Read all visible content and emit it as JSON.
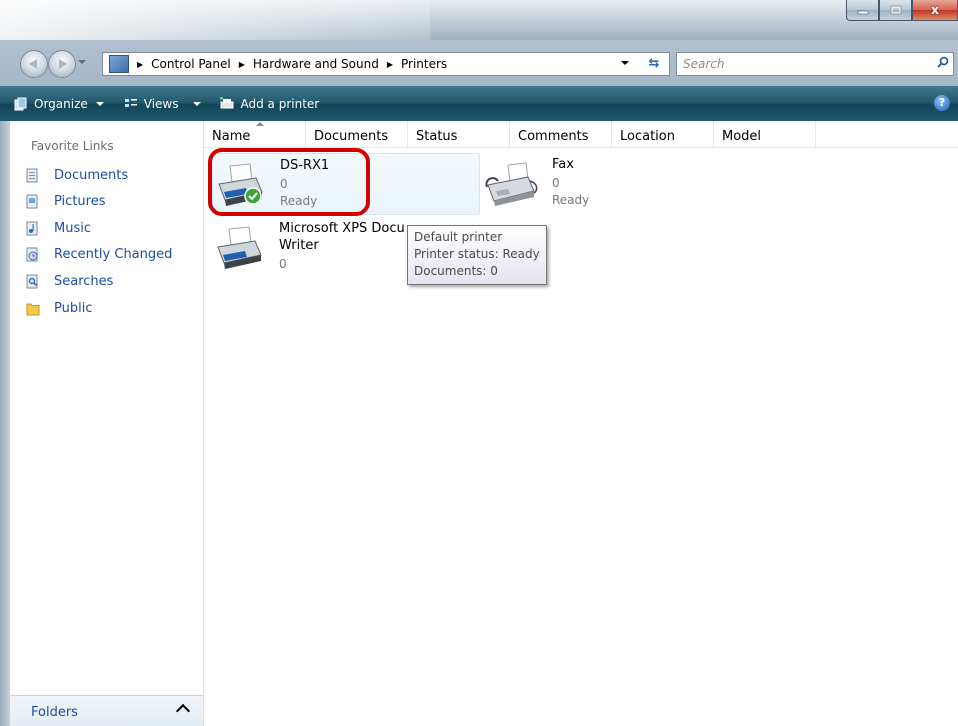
{
  "window": {
    "minimize_icon": "minimize-icon",
    "maximize_icon": "maximize-icon",
    "close_glyph": "x"
  },
  "address": {
    "breadcrumbs": [
      "Control Panel",
      "Hardware and Sound",
      "Printers"
    ],
    "search_placeholder": "Search"
  },
  "toolbar": {
    "organize_label": "Organize",
    "views_label": "Views",
    "add_printer_label": "Add a printer",
    "help_label": "?"
  },
  "sidebar": {
    "header": "Favorite Links",
    "items": [
      {
        "label": "Documents",
        "icon": "documents-folder-icon"
      },
      {
        "label": "Pictures",
        "icon": "pictures-folder-icon"
      },
      {
        "label": "Music",
        "icon": "music-folder-icon"
      },
      {
        "label": "Recently Changed",
        "icon": "recently-changed-icon"
      },
      {
        "label": "Searches",
        "icon": "searches-folder-icon"
      },
      {
        "label": "Public",
        "icon": "public-folder-icon"
      }
    ],
    "folders_label": "Folders"
  },
  "columns": [
    "Name",
    "Documents",
    "Status",
    "Comments",
    "Location",
    "Model"
  ],
  "printers": [
    {
      "name": "DS-RX1",
      "documents": "0",
      "status": "Ready",
      "is_default": true
    },
    {
      "name": "Fax",
      "documents": "0",
      "status": "Ready",
      "is_default": false
    },
    {
      "name_line1": "Microsoft XPS Docu",
      "name_line2": "Writer",
      "documents": "0",
      "is_default": false
    }
  ],
  "tooltip": {
    "line1": "Default printer",
    "line2": "Printer status: Ready",
    "line3": "Documents: 0"
  },
  "colors": {
    "highlight_ring": "#d30000",
    "link_blue": "#1d4da3",
    "toolbar_teal": "#1d5a6f"
  }
}
